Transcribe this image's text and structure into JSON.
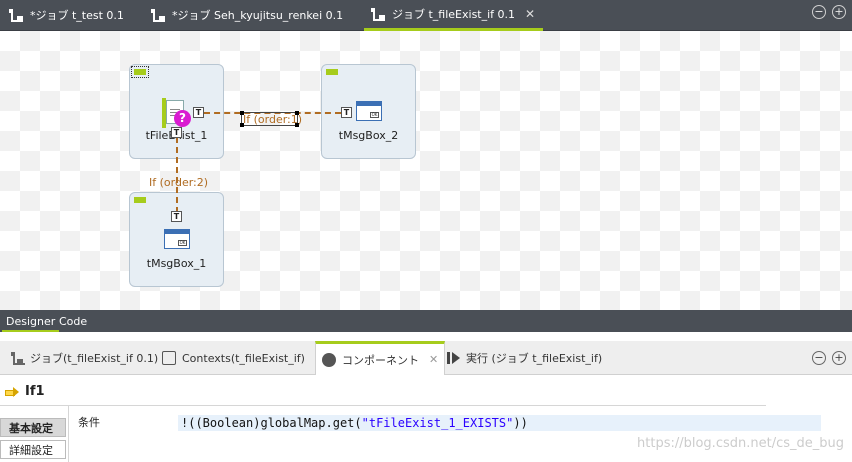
{
  "editor_tabs": [
    {
      "label": "*ジョブ t_test 0.1"
    },
    {
      "label": "*ジョブ Seh_kyujitsu_renkei 0.1"
    },
    {
      "label": "ジョブ t_fileExist_if 0.1",
      "close": "✕"
    }
  ],
  "window_buttons": {
    "minimize": "−",
    "maximize": "+"
  },
  "components": {
    "file_exist": {
      "label": "tFileExist_1"
    },
    "msgbox2": {
      "label": "tMsgBox_2"
    },
    "msgbox1": {
      "label": "tMsgBox_1"
    }
  },
  "ports": {
    "out": "T",
    "in": "T"
  },
  "links": {
    "if1": "If (order:1)",
    "if2": "If (order:2)"
  },
  "designer_tabs": {
    "designer": "Designer",
    "code": "Code"
  },
  "panel_tabs": [
    {
      "label": "ジョブ(t_fileExist_if 0.1)"
    },
    {
      "label": "Contexts(t_fileExist_if)"
    },
    {
      "label": "コンポーネント",
      "close": "✕"
    },
    {
      "label": "実行 (ジョブ t_fileExist_if)"
    }
  ],
  "component_title": "If1",
  "side_tabs": {
    "basic": "基本設定",
    "advanced": "詳細設定"
  },
  "condition": {
    "label": "条件",
    "prefix": "!((Boolean)globalMap.get(",
    "string": "\"tFileExist_1_EXISTS\"",
    "suffix": "))"
  },
  "watermark": "https://blog.csdn.net/cs_de_bug",
  "colors": {
    "accent": "#a6cc1c",
    "link": "#b06c22",
    "tabbar": "#4a4f56"
  }
}
